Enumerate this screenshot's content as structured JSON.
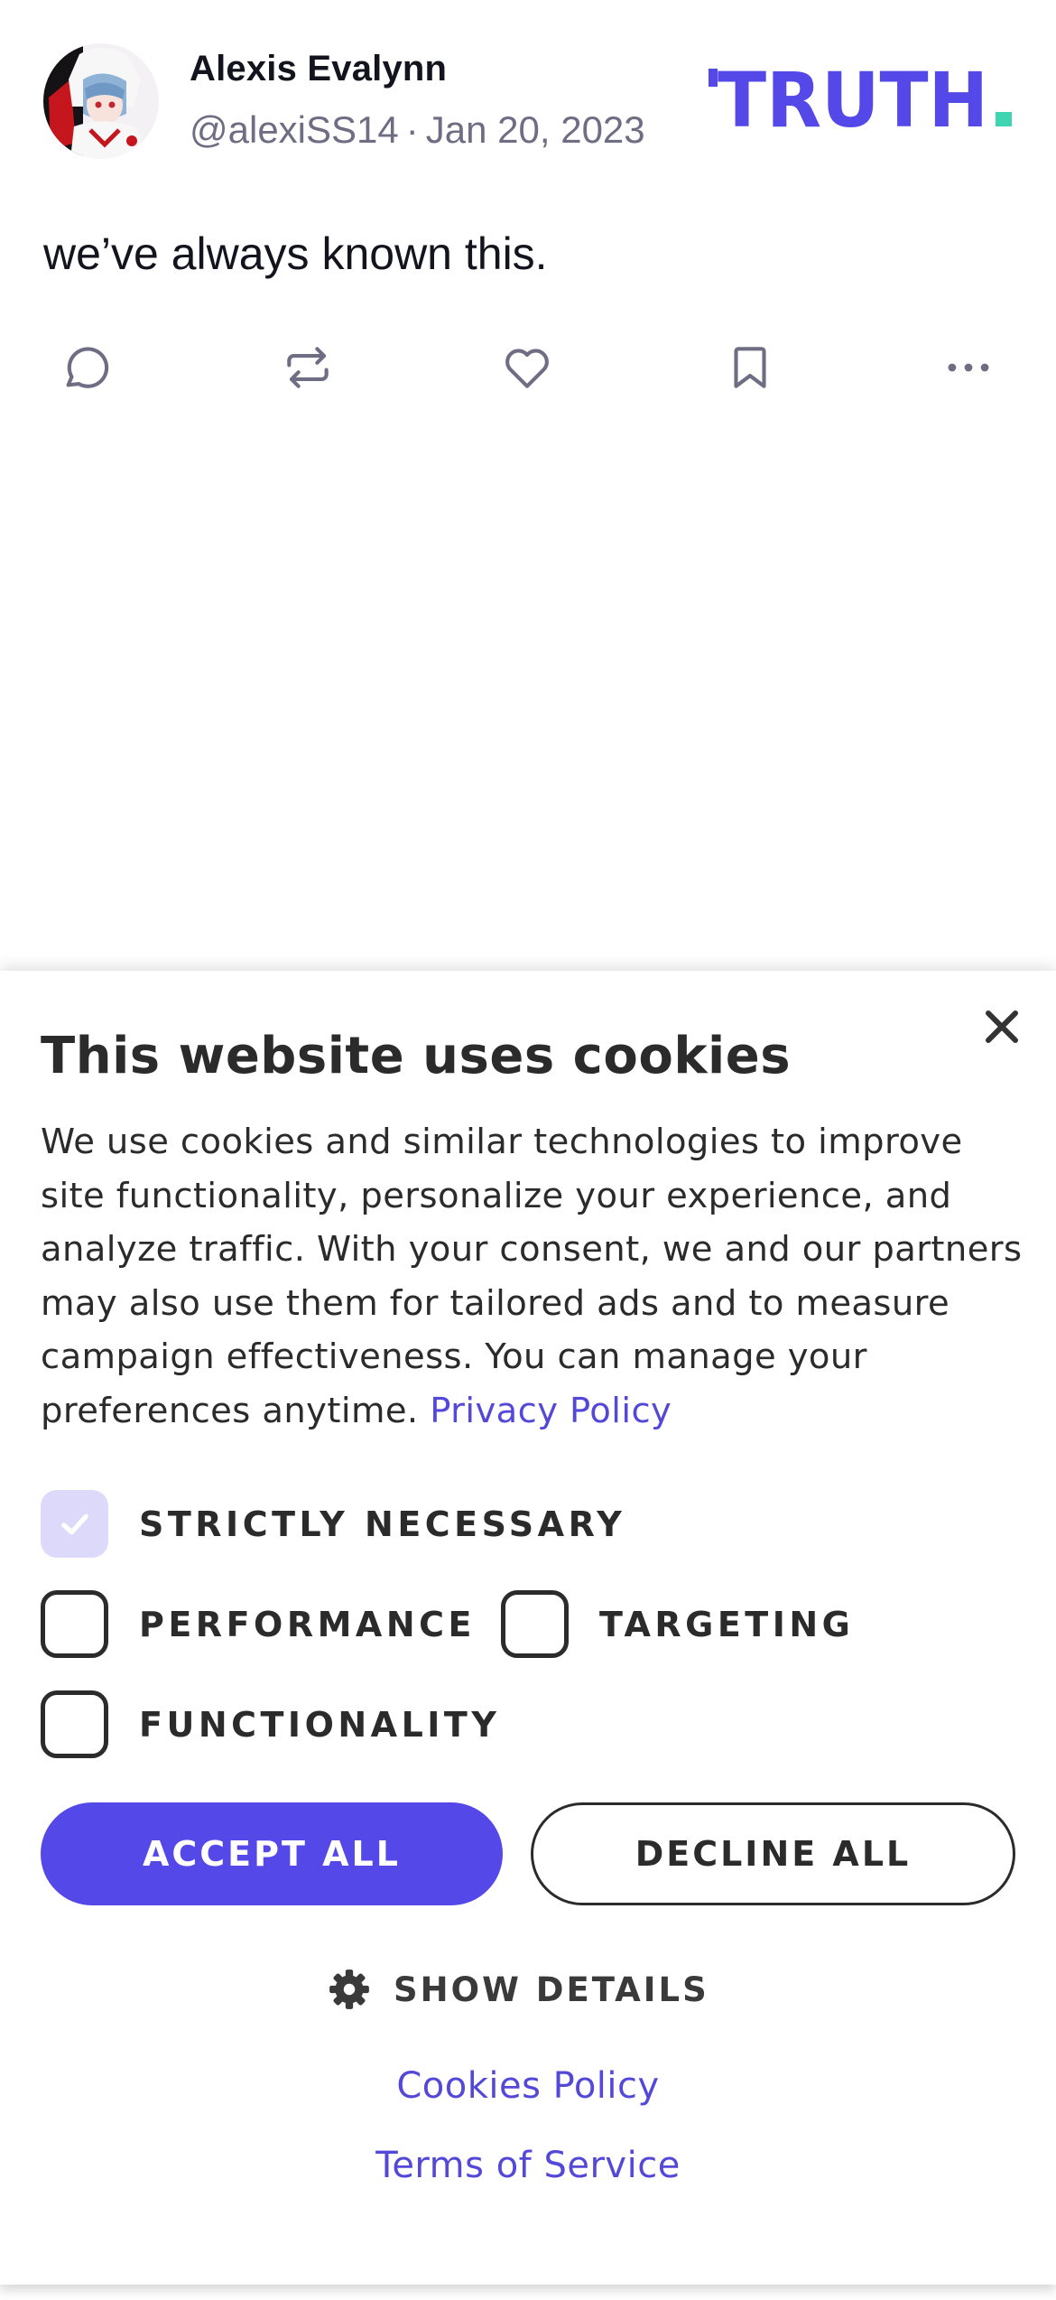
{
  "post": {
    "author_name": "Alexis Evalynn",
    "author_handle": "@alexiSS14",
    "separator": "·",
    "date": "Jan 20, 2023",
    "text": "we’ve always known this.",
    "brand": "TRUTH",
    "brand_color": "#5448e8",
    "brand_dot_color": "#3ed5b0",
    "actions": [
      {
        "name": "reply",
        "icon": "comment-bubble-icon"
      },
      {
        "name": "retruth",
        "icon": "repost-arrows-icon"
      },
      {
        "name": "like",
        "icon": "heart-icon"
      },
      {
        "name": "bookmark",
        "icon": "bookmark-icon"
      },
      {
        "name": "more",
        "icon": "ellipsis-icon"
      }
    ]
  },
  "cookie_banner": {
    "title": "This website uses cookies",
    "body": "We use cookies and similar technologies to improve site functionality, personalize your experience, and analyze traffic. With your consent, we and our partners may also use them for tailored ads and to measure campaign effectiveness. You can manage your preferences anytime.",
    "privacy_link": "Privacy Policy",
    "options": [
      {
        "label": "STRICTLY NECESSARY",
        "checked": true
      },
      {
        "label": "PERFORMANCE",
        "checked": false
      },
      {
        "label": "TARGETING",
        "checked": false
      },
      {
        "label": "FUNCTIONALITY",
        "checked": false
      }
    ],
    "accept_label": "ACCEPT ALL",
    "decline_label": "DECLINE ALL",
    "show_details_label": "SHOW DETAILS",
    "cookies_policy_link": "Cookies Policy",
    "terms_link": "Terms of Service",
    "accent_color": "#5448e8",
    "link_color": "#5448d8"
  }
}
